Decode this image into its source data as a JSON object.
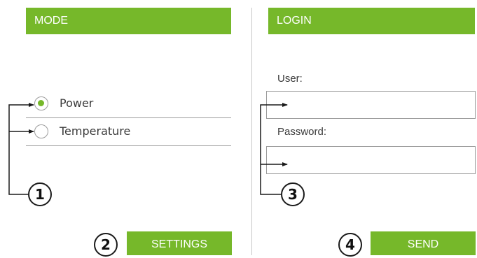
{
  "mode": {
    "title": "MODE",
    "options": [
      {
        "label": "Power",
        "selected": true
      },
      {
        "label": "Temperature",
        "selected": false
      }
    ],
    "settings_label": "SETTINGS"
  },
  "login": {
    "title": "LOGIN",
    "user_label": "User:",
    "user_value": "",
    "password_label": "Password:",
    "password_value": "",
    "send_label": "SEND"
  },
  "callouts": [
    "1",
    "2",
    "3",
    "4"
  ],
  "colors": {
    "accent": "#76b82a",
    "text": "#3a3a3a",
    "border": "#9d9d9d",
    "callout": "#1a1a1a"
  }
}
